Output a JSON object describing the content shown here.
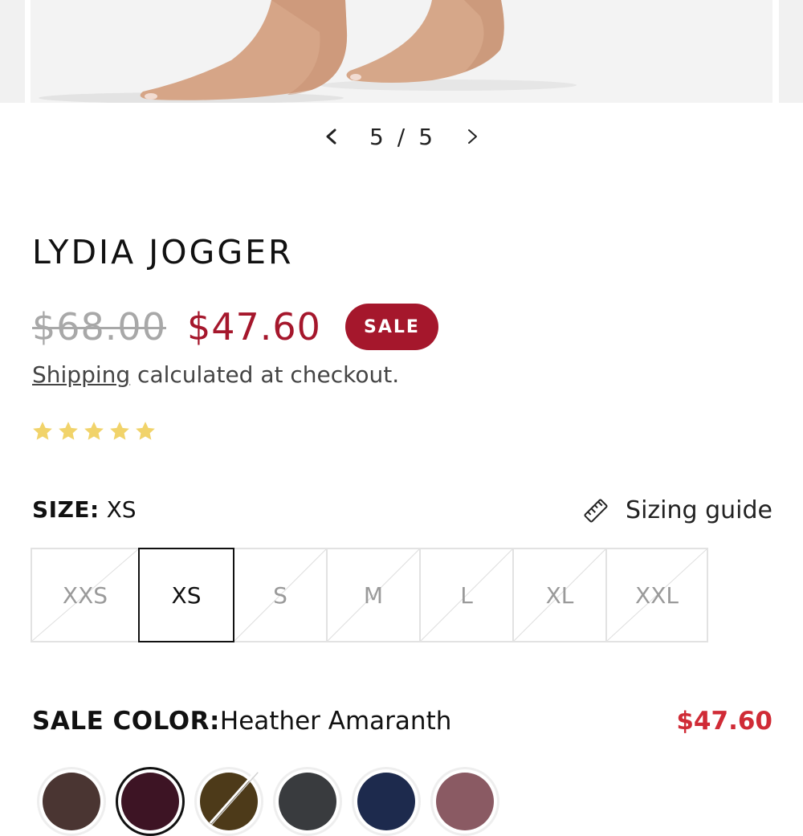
{
  "gallery": {
    "current": "5",
    "separator": "/",
    "total": "5",
    "prev_icon": "chevron-left-icon",
    "next_icon": "chevron-right-icon"
  },
  "product": {
    "title": "LYDIA JOGGER",
    "compare_price": "$68.00",
    "price": "$47.60",
    "sale_badge": "SALE",
    "shipping_link": "Shipping",
    "shipping_text": " calculated at checkout.",
    "rating": 5,
    "star_color": "#f1d36a"
  },
  "size": {
    "label": "SIZE:",
    "selected": "XS",
    "guide_label": "Sizing guide",
    "guide_icon": "ruler-icon",
    "options": [
      {
        "label": "XXS",
        "available": false
      },
      {
        "label": "XS",
        "available": true,
        "selected": true
      },
      {
        "label": "S",
        "available": false
      },
      {
        "label": "M",
        "available": false
      },
      {
        "label": "L",
        "available": false
      },
      {
        "label": "XL",
        "available": false
      },
      {
        "label": "XXL",
        "available": false
      }
    ]
  },
  "color": {
    "label": "SALE COLOR:",
    "selected": "Heather Amaranth",
    "price": "$47.60",
    "swatches": [
      {
        "color": "#4a3532"
      },
      {
        "color": "#3d1424",
        "selected": true
      },
      {
        "color": "#4d3a19",
        "unavailable": true
      },
      {
        "color": "#393b3e"
      },
      {
        "color": "#1d2a4d"
      },
      {
        "color": "#8a5a63"
      }
    ]
  },
  "colors": {
    "sale_red": "#a5172c",
    "price_red": "#d02b36",
    "muted": "#a8a8a8"
  }
}
